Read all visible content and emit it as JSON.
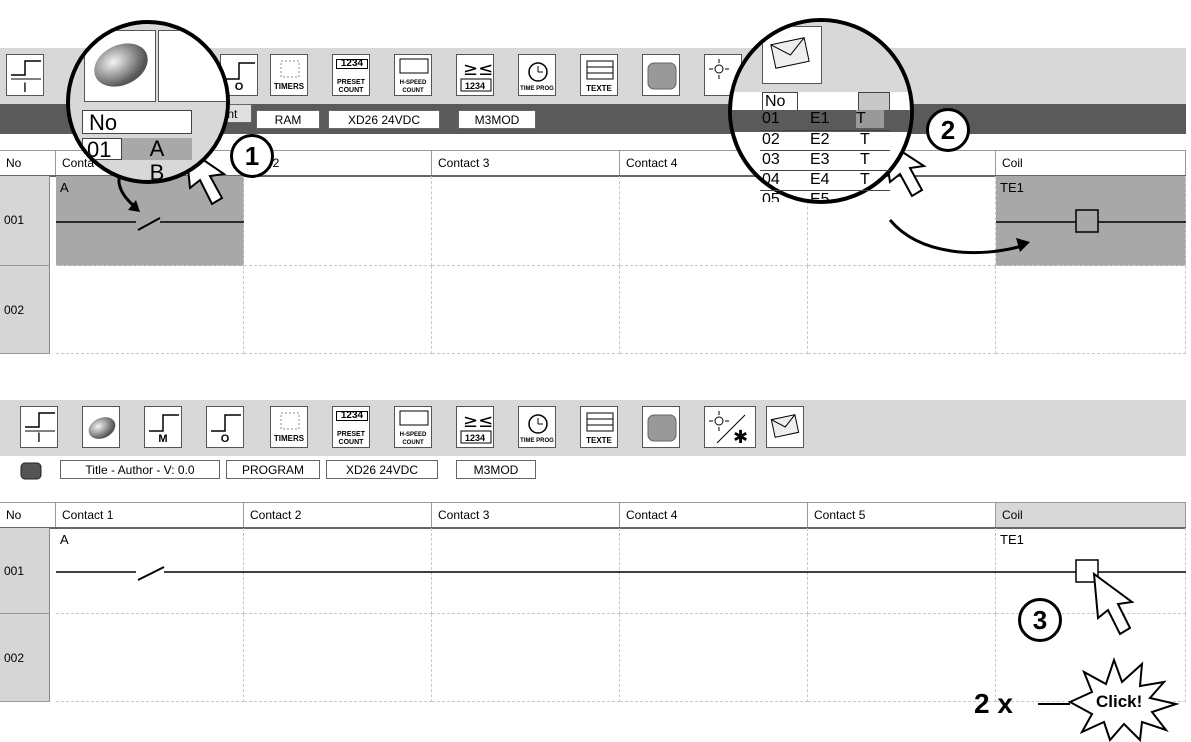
{
  "toolbar_top": {
    "buttons": [
      {
        "icon": "input-contact-icon",
        "label": "I"
      },
      {
        "icon": "memory-ellipse-icon",
        "label": ""
      },
      {
        "icon": "memory-contact-icon",
        "label": "M"
      },
      {
        "icon": "output-contact-icon",
        "label": "O"
      },
      {
        "icon": "timers-icon",
        "label": "TIMERS"
      },
      {
        "icon": "preset-count-icon",
        "label": "PRESET COUNT"
      },
      {
        "icon": "hspeed-count-icon",
        "label": "H-SPEED COUNT"
      },
      {
        "icon": "compare-icon",
        "label": "1234"
      },
      {
        "icon": "time-prog-icon",
        "label": "TIME PROG"
      },
      {
        "icon": "texte-icon",
        "label": "TEXTE"
      },
      {
        "icon": "grey-block-icon",
        "label": ""
      },
      {
        "icon": "light-icon",
        "label": ""
      },
      {
        "icon": "envelope-icon",
        "label": ""
      }
    ]
  },
  "infobar_top": {
    "partial_left": "ment",
    "program": "RAM",
    "module": "XD26 24VDC",
    "ext": "M3MOD"
  },
  "infobar": {
    "title": "Title - Author - V: 0.0",
    "program": "PROGRAM",
    "module": "XD26 24VDC",
    "ext": "M3MOD"
  },
  "grid_headers": {
    "no": "No",
    "c1": "Contact 1",
    "c2": "Contact 2",
    "c3": "Contact 3",
    "c4": "Contact 4",
    "c5": "Contact 5",
    "coil": "Coil"
  },
  "grid_headers_top": {
    "no": "No",
    "c1": "Conta",
    "c2": "tact 2",
    "c3": "Contact 3",
    "c4": "Contact 4",
    "coil": "Coil"
  },
  "rows": [
    {
      "no": "001",
      "contact1": "A",
      "coil": "TE1"
    },
    {
      "no": "002"
    }
  ],
  "zoom1": {
    "header": "No",
    "row_no": "01",
    "row_val": "A",
    "row2_val": "B",
    "step": "1"
  },
  "zoom2": {
    "header": "No",
    "rows": [
      {
        "no": "01",
        "name": "E1",
        "type": "T"
      },
      {
        "no": "02",
        "name": "E2",
        "type": "T"
      },
      {
        "no": "03",
        "name": "E3",
        "type": "T"
      },
      {
        "no": "04",
        "name": "E4",
        "type": "T"
      },
      {
        "no": "05",
        "name": "E5",
        "type": ""
      }
    ],
    "step": "2"
  },
  "step3": "3",
  "click_count": "2 x",
  "click_label": "Click!",
  "colors": {
    "selected_cell": "#a8a8a8",
    "toolbar_bg": "#d8d8d8",
    "dark_bar": "#5a5a5a"
  }
}
